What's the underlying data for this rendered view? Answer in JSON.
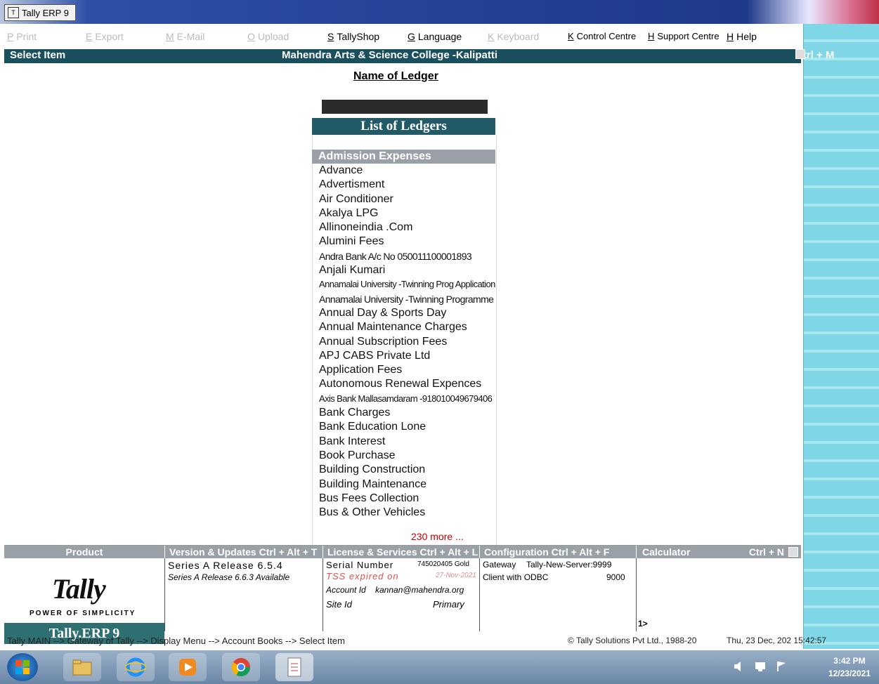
{
  "window": {
    "title": "Tally ERP 9"
  },
  "menu": {
    "items": [
      {
        "key": "P",
        "label": "Print",
        "dim": true
      },
      {
        "key": "E",
        "label": "Export",
        "dim": true
      },
      {
        "key": "M",
        "label": "E-Mail",
        "dim": true
      },
      {
        "key": "O",
        "label": "Upload",
        "dim": true
      },
      {
        "key": "S",
        "label": "TallyShop",
        "dim": false
      },
      {
        "key": "G",
        "label": "Language",
        "dim": false
      },
      {
        "key": "K",
        "label": "Keyboard",
        "dim": true
      },
      {
        "key": "K",
        "label": "Control Centre",
        "dim": false
      },
      {
        "key": "H",
        "label": "Support Centre",
        "dim": false
      },
      {
        "key": "H",
        "label": "Help",
        "dim": false
      }
    ]
  },
  "header": {
    "left": "Select Item",
    "center": "Mahendra Arts & Science College -Kalipatti",
    "right": "Ctrl + M"
  },
  "ledger": {
    "title": "Name of Ledger",
    "input_value": "",
    "list_title": "List of Ledgers",
    "selected": "Admission Expenses",
    "items": [
      "Advance",
      "Advertisment",
      "Air Conditioner",
      "Akalya LPG",
      "Allinoneindia .Com",
      "Alumini Fees",
      "Andra Bank A/c No 050011100001893",
      "Anjali Kumari",
      "Annamalai University -Twinning Prog Application",
      "Annamalai University -Twinning Programme",
      "Annual Day & Sports Day",
      "Annual Maintenance Charges",
      "Annual Subscription Fees",
      "APJ CABS Private Ltd",
      "Application Fees",
      "Autonomous Renewal Expences",
      "Axis Bank Mallasamdaram -918010049679406",
      "Bank Charges",
      "Bank Education Lone",
      "Bank Interest",
      "Book Purchase",
      "Building Construction",
      "Building Maintenance",
      "Bus Fees Collection",
      "Bus & Other Vehicles"
    ],
    "more": "230 more ..."
  },
  "bottom": {
    "product": {
      "header": "Product",
      "logo": "Tally",
      "tagline": "POWER OF SIMPLICITY",
      "edition": "Tally.ERP 9"
    },
    "version": {
      "header": "Version & Updates Ctrl + Alt + T",
      "line1": "Series A Release 6.5.4",
      "line2": "Series A Release 6.6.3 Available"
    },
    "license": {
      "header": "License & Services Ctrl + Alt + L",
      "serial_label": "Serial Number",
      "serial_value": "745020405 Gold",
      "tss_label": "TSS expired on",
      "tss_value": "27-Nov-2021",
      "account_label": "Account Id",
      "account_value": "kannan@mahendra.org",
      "site_label": "Site Id",
      "site_value": "Primary"
    },
    "config": {
      "header": "Configuration Ctrl + Alt + F",
      "line1_label": "Gateway",
      "line1_value": "Tally-New-Server:9999",
      "line2_label": "Client with ODBC",
      "line2_value": "9000"
    },
    "calculator": {
      "header": "Calculator",
      "hotkey": "Ctrl + N",
      "prompt": "1>"
    }
  },
  "status": {
    "breadcrumb": "Tally MAIN --> Gateway of Tally --> Display Menu --> Account Books --> Select Item",
    "copyright": "© Tally Solutions Pvt Ltd., 1988-20",
    "datetime": "Thu, 23 Dec, 202 15:42:57"
  },
  "taskbar": {
    "time": "3:42 PM",
    "date": "12/23/2021"
  }
}
